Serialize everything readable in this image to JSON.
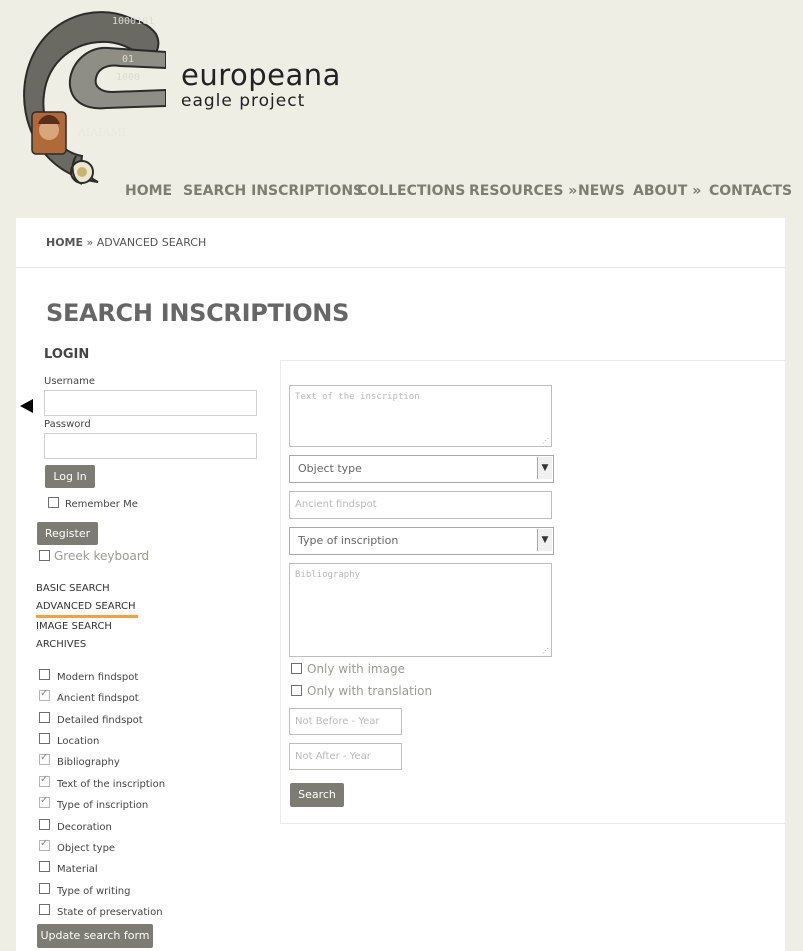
{
  "brand": {
    "name": "europeana",
    "subtitle": "eagle project"
  },
  "nav": [
    "HOME",
    "SEARCH INSCRIPTIONS",
    "COLLECTIONS",
    "RESOURCES »",
    "NEWS",
    "ABOUT »",
    "CONTACTS"
  ],
  "breadcrumb": {
    "home": "HOME",
    "separator": "»",
    "current": "ADVANCED SEARCH"
  },
  "page_title": "SEARCH INSCRIPTIONS",
  "login": {
    "title": "LOGIN",
    "username_label": "Username",
    "password_label": "Password",
    "login_button": "Log In",
    "remember_me": "Remember Me",
    "register_button": "Register",
    "greek_keyboard": "Greek keyboard"
  },
  "search_links": [
    "BASIC SEARCH",
    "ADVANCED SEARCH",
    "IMAGE SEARCH",
    "ARCHIVES"
  ],
  "active_search_link": "ADVANCED SEARCH",
  "field_options": [
    {
      "label": "Modern findspot",
      "checked": false
    },
    {
      "label": "Ancient findspot",
      "checked": true
    },
    {
      "label": "Detailed findspot",
      "checked": false
    },
    {
      "label": "Location",
      "checked": false
    },
    {
      "label": "Bibliography",
      "checked": true
    },
    {
      "label": "Text of the inscription",
      "checked": true
    },
    {
      "label": "Type of inscription",
      "checked": true
    },
    {
      "label": "Decoration",
      "checked": false
    },
    {
      "label": "Object type",
      "checked": true
    },
    {
      "label": "Material",
      "checked": false
    },
    {
      "label": "Type of writing",
      "checked": false
    },
    {
      "label": "State of preservation",
      "checked": false
    }
  ],
  "update_button": "Update search form",
  "form": {
    "text_placeholder": "Text of the inscription",
    "object_type": "Object type",
    "ancient_findspot_placeholder": "Ancient findspot",
    "type_of_inscription": "Type of inscription",
    "bibliography_placeholder": "Bibliography",
    "only_with_image": "Only with image",
    "only_with_translation": "Only with translation",
    "not_before_placeholder": "Not Before - Year",
    "not_after_placeholder": "Not After - Year",
    "search_button": "Search"
  },
  "colors": {
    "background": "#eeeee4",
    "nav": "#7d7d72",
    "button": "#7c7c72",
    "accent": "#f2a13c"
  }
}
